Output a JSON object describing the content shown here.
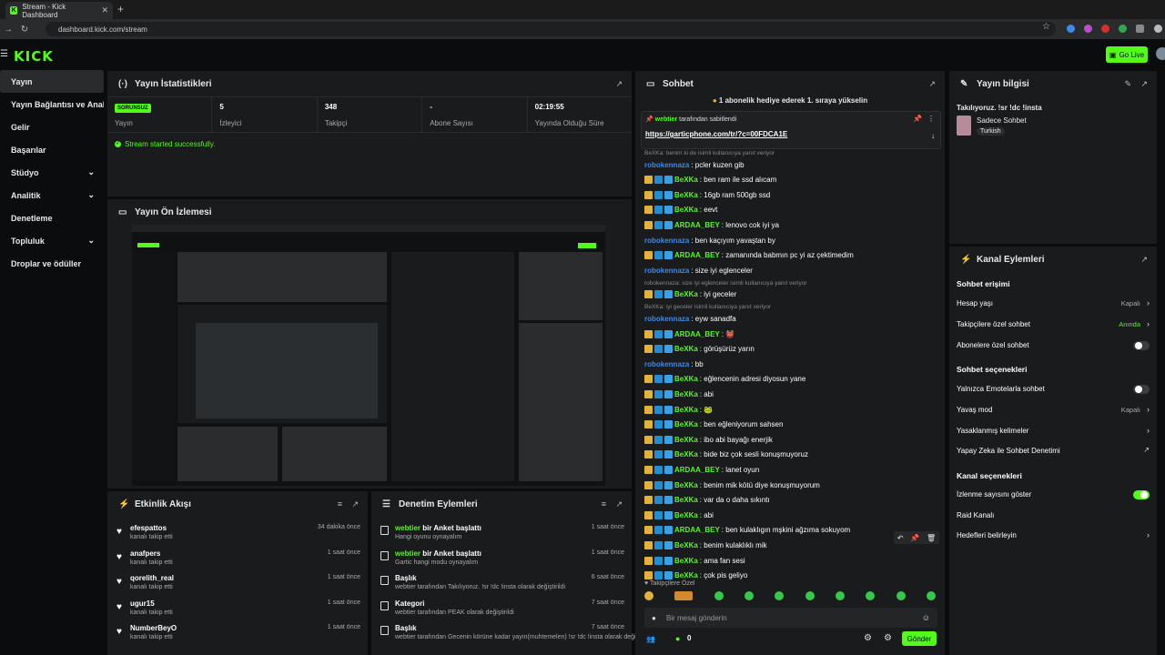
{
  "browser": {
    "tab_title": "Stream - Kick Dashboard",
    "url": "dashboard.kick.com/stream"
  },
  "app": {
    "logo": "KICK",
    "go_live": "Go Live"
  },
  "sidebar": {
    "items": [
      {
        "label": "Yayın",
        "active": true,
        "chevron": false
      },
      {
        "label": "Yayın Bağlantısı ve Anahtarı",
        "active": false,
        "chevron": false
      },
      {
        "label": "Gelir",
        "active": false,
        "chevron": false
      },
      {
        "label": "Başarılar",
        "active": false,
        "chevron": false
      },
      {
        "label": "Stüdyo",
        "active": false,
        "chevron": true
      },
      {
        "label": "Analitik",
        "active": false,
        "chevron": true
      },
      {
        "label": "Denetleme",
        "active": false,
        "chevron": false
      },
      {
        "label": "Topluluk",
        "active": false,
        "chevron": true
      },
      {
        "label": "Droplar ve ödüller",
        "active": false,
        "chevron": false
      }
    ]
  },
  "stats": {
    "title": "Yayın İstatistikleri",
    "badge": "SORUNSUZ",
    "items": [
      {
        "value": "",
        "label": "Yayın"
      },
      {
        "value": "5",
        "label": "İzleyici"
      },
      {
        "value": "348",
        "label": "Takipçi"
      },
      {
        "value": "-",
        "label": "Abone Sayısı"
      },
      {
        "value": "02:19:55",
        "label": "Yayında Olduğu Süre"
      }
    ],
    "message": "Stream started successfully."
  },
  "preview": {
    "title": "Yayın Ön İzlemesi"
  },
  "activity": {
    "title": "Etkinlik Akışı",
    "items": [
      {
        "name": "efespattos",
        "sub": "kanalı takip etti",
        "time": "34 dakika önce"
      },
      {
        "name": "anafpers",
        "sub": "kanalı takip etti",
        "time": "1 saat önce"
      },
      {
        "name": "qorelith_real",
        "sub": "kanalı takip etti",
        "time": "1 saat önce"
      },
      {
        "name": "ugur15",
        "sub": "kanalı takip etti",
        "time": "1 saat önce"
      },
      {
        "name": "NumberBeyO",
        "sub": "kanalı takip etti",
        "time": "1 saat önce"
      }
    ]
  },
  "moderation": {
    "title": "Denetim Eylemleri",
    "items": [
      {
        "user": "webtier",
        "action": " bir Anket başlattı",
        "sub": "Hangi oyunu oynayalım",
        "time": "1 saat önce"
      },
      {
        "user": "webtier",
        "action": " bir Anket başlattı",
        "sub": "Gartic hangi modu oynayalım",
        "time": "1 saat önce"
      },
      {
        "user": "",
        "action": "Başlık",
        "sub": "webtier tarafından Takılıyoruz. !sr !dc !insta olarak değiştirildi",
        "time": "6 saat önce"
      },
      {
        "user": "",
        "action": "Kategori",
        "sub": "webtier tarafından PEAK olarak değiştirildi",
        "time": "7 saat önce"
      },
      {
        "user": "",
        "action": "Başlık",
        "sub": "webtier tarafından Gecenin körüne kadar yayın(muhtemelen) !sr !dc !insta olarak değiştirildi",
        "time": "7 saat önce"
      }
    ]
  },
  "chat": {
    "title": "Sohbet",
    "banner": "1 abonelik hediye ederek 1. sıraya yükselin",
    "pinned_by": "webtier",
    "pinned_by_suffix": " tarafından sabitlendi",
    "pinned_link": "https://garticphone.com/tr/?c=00FDCA1E",
    "messages": [
      {
        "type": "reply",
        "text": "BeXKa: benim ki de isimli kullanıcıya yanıt veriyor"
      },
      {
        "type": "msg",
        "user": "robokennaza",
        "color": "blue",
        "badges": 0,
        "text": ": pcler kuzen gib"
      },
      {
        "type": "msg",
        "user": "BeXKa",
        "color": "green",
        "badges": 3,
        "text": ": ben ram ile ssd alıcam"
      },
      {
        "type": "msg",
        "user": "BeXKa",
        "color": "green",
        "badges": 3,
        "text": ": 16gb ram 500gb ssd"
      },
      {
        "type": "msg",
        "user": "BeXKa",
        "color": "green",
        "badges": 3,
        "text": ": eevt"
      },
      {
        "type": "msg",
        "user": "ARDAA_BEY",
        "color": "green",
        "badges": 3,
        "text": ": lenovo cok iyi ya"
      },
      {
        "type": "msg",
        "user": "robokennaza",
        "color": "blue",
        "badges": 0,
        "text": ": ben kaçıyım yavaştan by"
      },
      {
        "type": "msg",
        "user": "ARDAA_BEY",
        "color": "green",
        "badges": 3,
        "text": ": zamanında babmın pc yi az çektimedim"
      },
      {
        "type": "msg",
        "user": "robokennaza",
        "color": "blue",
        "badges": 0,
        "text": ": size iyi eglenceler"
      },
      {
        "type": "reply",
        "text": "robokennaza: size iyi eglenceler isimli kullanıcıya yanıt veriyor"
      },
      {
        "type": "msg",
        "user": "BeXKa",
        "color": "green",
        "badges": 3,
        "text": ": iyi geceler"
      },
      {
        "type": "reply",
        "text": "BeXKa: iyi geceler isimli kullanıcıya yanıt veriyor"
      },
      {
        "type": "msg",
        "user": "robokennaza",
        "color": "blue",
        "badges": 0,
        "text": ": eyw sanadfa"
      },
      {
        "type": "msg",
        "user": "ARDAA_BEY",
        "color": "green",
        "badges": 3,
        "text": ": 👹"
      },
      {
        "type": "msg",
        "user": "BeXKa",
        "color": "green",
        "badges": 3,
        "text": ": görüşürüz yarın"
      },
      {
        "type": "msg",
        "user": "robokennaza",
        "color": "blue",
        "badges": 0,
        "text": ": bb"
      },
      {
        "type": "msg",
        "user": "BeXKa",
        "color": "green",
        "badges": 3,
        "text": ": eğlencenin adresi diyosun yane"
      },
      {
        "type": "msg",
        "user": "BeXKa",
        "color": "green",
        "badges": 3,
        "text": ": abi"
      },
      {
        "type": "msg",
        "user": "BeXKa",
        "color": "green",
        "badges": 3,
        "text": ": 🐸"
      },
      {
        "type": "msg",
        "user": "BeXKa",
        "color": "green",
        "badges": 3,
        "text": ": ben eğleniyorum sahsen"
      },
      {
        "type": "msg",
        "user": "BeXKa",
        "color": "green",
        "badges": 3,
        "text": ": ibo abi bayağı enerjik"
      },
      {
        "type": "msg",
        "user": "BeXKa",
        "color": "green",
        "badges": 3,
        "text": ": bide biz çok sesli konuşmuyoruz"
      },
      {
        "type": "msg",
        "user": "ARDAA_BEY",
        "color": "green",
        "badges": 3,
        "text": ": lanet oyun"
      },
      {
        "type": "msg",
        "user": "BeXKa",
        "color": "green",
        "badges": 3,
        "text": ": benim mik kötü diye konuşmuyorum"
      },
      {
        "type": "msg",
        "user": "BeXKa",
        "color": "green",
        "badges": 3,
        "text": ": var da o daha sıkıntı"
      },
      {
        "type": "msg",
        "user": "BeXKa",
        "color": "green",
        "badges": 3,
        "text": ": abi"
      },
      {
        "type": "msg",
        "user": "ARDAA_BEY",
        "color": "green",
        "badges": 3,
        "text": ": ben kulaklıgın mşkini ağzıma sokuyom"
      },
      {
        "type": "msg",
        "user": "BeXKa",
        "color": "green",
        "badges": 3,
        "text": ": benim kulaklıklı mik"
      },
      {
        "type": "msg",
        "user": "BeXKa",
        "color": "green",
        "badges": 3,
        "text": ": ama fan sesi"
      },
      {
        "type": "msg",
        "user": "BeXKa",
        "color": "green",
        "badges": 3,
        "text": ": çok pis geliyo"
      }
    ],
    "followers_only": "Takipçilere Özel",
    "input_placeholder": "Bir mesaj gönderin",
    "viewers_count": "0",
    "send_label": "Gönder"
  },
  "stream_info": {
    "title": "Yayın bilgisi",
    "stream_title": "Takılıyoruz. !sr !dc !insta",
    "category": "Sadece Sohbet",
    "tag": "Turkish"
  },
  "channel": {
    "title": "Kanal Eylemleri",
    "sections": {
      "chat_access": "Sohbet erişimi",
      "chat_options": "Sohbet seçenekleri",
      "channel_options": "Kanal seçenekleri"
    },
    "rows": {
      "account_age": {
        "label": "Hesap yaşı",
        "value": "Kapalı"
      },
      "followers_only": {
        "label": "Takipçilere özel sohbet",
        "value": "Anında"
      },
      "subscribers_only": {
        "label": "Abonelere özel sohbet"
      },
      "emotes_only": {
        "label": "Yalnızca Emotelarla sohbet"
      },
      "slow_mode": {
        "label": "Yavaş mod",
        "value": "Kapalı"
      },
      "banned_words": {
        "label": "Yasaklanmış kelimeler"
      },
      "ai_mod": {
        "label": "Yapay Zeka ile Sohbet Denetimi"
      },
      "show_viewers": {
        "label": "İzlenme sayısını göster"
      },
      "raid": {
        "label": "Raid Kanalı"
      },
      "goals": {
        "label": "Hedefleri belirleyin"
      }
    }
  }
}
